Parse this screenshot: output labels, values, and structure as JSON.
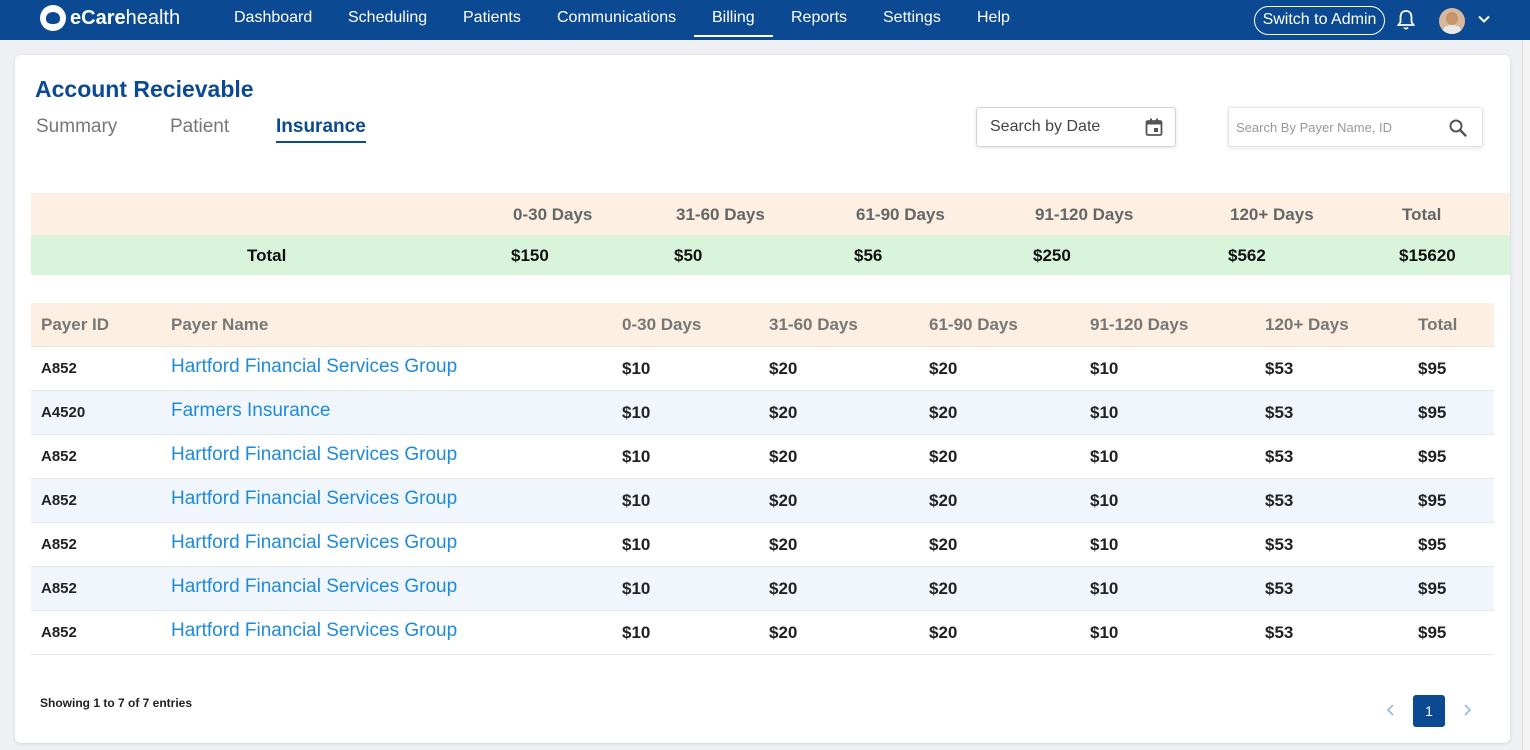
{
  "brand": {
    "name_bold": "eCare",
    "name_light": "health"
  },
  "nav": {
    "items": [
      "Dashboard",
      "Scheduling",
      "Patients",
      "Communications",
      "Billing",
      "Reports",
      "Settings",
      "Help"
    ],
    "active": "Billing",
    "switch_label": "Switch to Admin"
  },
  "page": {
    "title": "Account Recievable",
    "tabs": [
      "Summary",
      "Patient",
      "Insurance"
    ],
    "active_tab": "Insurance",
    "date_placeholder": "Search by Date",
    "search_placeholder": "Search By Payer Name, ID"
  },
  "summary": {
    "headers": [
      "0-30 Days",
      "31-60 Days",
      "61-90 Days",
      "91-120 Days",
      "120+ Days",
      "Total"
    ],
    "row_label": "Total",
    "values": [
      "$150",
      "$50",
      "$56",
      "$250",
      "$562",
      "$15620"
    ]
  },
  "table": {
    "headers": [
      "Payer ID",
      "Payer Name",
      "0-30 Days",
      "31-60 Days",
      "61-90 Days",
      "91-120 Days",
      "120+ Days",
      "Total"
    ],
    "rows": [
      [
        "A852",
        "Hartford Financial Services Group",
        "$10",
        "$20",
        "$20",
        "$10",
        "$53",
        "$95"
      ],
      [
        "A4520",
        "Farmers Insurance",
        "$10",
        "$20",
        "$20",
        "$10",
        "$53",
        "$95"
      ],
      [
        "A852",
        "Hartford Financial Services Group",
        "$10",
        "$20",
        "$20",
        "$10",
        "$53",
        "$95"
      ],
      [
        "A852",
        "Hartford Financial Services Group",
        "$10",
        "$20",
        "$20",
        "$10",
        "$53",
        "$95"
      ],
      [
        "A852",
        "Hartford Financial Services Group",
        "$10",
        "$20",
        "$20",
        "$10",
        "$53",
        "$95"
      ],
      [
        "A852",
        "Hartford Financial Services Group",
        "$10",
        "$20",
        "$20",
        "$10",
        "$53",
        "$95"
      ],
      [
        "A852",
        "Hartford Financial Services Group",
        "$10",
        "$20",
        "$20",
        "$10",
        "$53",
        "$95"
      ]
    ]
  },
  "footer": {
    "entries_text": "Showing 1 to 7 of 7 entries",
    "page": "1"
  },
  "colors": {
    "primary": "#0b4a93",
    "link": "#1e8ad8",
    "header_bg": "#fdf0e2",
    "total_bg": "#d8f5dc",
    "alt_row": "#f1f6fc"
  }
}
